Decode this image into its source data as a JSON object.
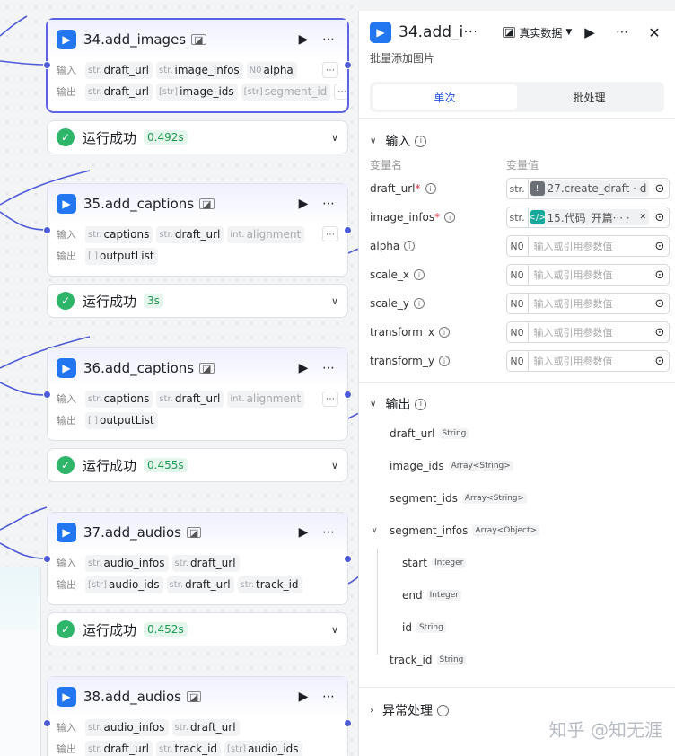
{
  "nodes": [
    {
      "title": "34.add_images",
      "input_label": "输入",
      "output_label": "输出",
      "inputs": [
        {
          "type": "str.",
          "name": "draft_url"
        },
        {
          "type": "str.",
          "name": "image_infos"
        },
        {
          "type": "N0",
          "name": "alpha"
        }
      ],
      "outputs": [
        {
          "type": "str.",
          "name": "draft_url"
        },
        {
          "type": "[str]",
          "name": "image_ids"
        },
        {
          "type": "[str]",
          "name": "segment_id"
        }
      ],
      "status": "运行成功",
      "time": "0.492s"
    },
    {
      "title": "35.add_captions",
      "input_label": "输入",
      "output_label": "输出",
      "inputs": [
        {
          "type": "str.",
          "name": "captions"
        },
        {
          "type": "str.",
          "name": "draft_url"
        },
        {
          "type": "int.",
          "name": "alignment"
        }
      ],
      "outputs": [
        {
          "type": "[ ]",
          "name": "outputList"
        }
      ],
      "status": "运行成功",
      "time": "3s"
    },
    {
      "title": "36.add_captions",
      "input_label": "输入",
      "output_label": "输出",
      "inputs": [
        {
          "type": "str.",
          "name": "captions"
        },
        {
          "type": "str.",
          "name": "draft_url"
        },
        {
          "type": "int.",
          "name": "alignment"
        }
      ],
      "outputs": [
        {
          "type": "[ ]",
          "name": "outputList"
        }
      ],
      "status": "运行成功",
      "time": "0.455s"
    },
    {
      "title": "37.add_audios",
      "input_label": "输入",
      "output_label": "输出",
      "inputs": [
        {
          "type": "str.",
          "name": "audio_infos"
        },
        {
          "type": "str.",
          "name": "draft_url"
        }
      ],
      "outputs": [
        {
          "type": "[str]",
          "name": "audio_ids"
        },
        {
          "type": "str.",
          "name": "draft_url"
        },
        {
          "type": "str.",
          "name": "track_id"
        }
      ],
      "status": "运行成功",
      "time": "0.452s"
    },
    {
      "title": "38.add_audios",
      "input_label": "输入",
      "output_label": "输出",
      "inputs": [
        {
          "type": "str.",
          "name": "audio_infos"
        },
        {
          "type": "str.",
          "name": "draft_url"
        }
      ],
      "outputs": [
        {
          "type": "str.",
          "name": "draft_url"
        },
        {
          "type": "str.",
          "name": "track_id"
        },
        {
          "type": "[str]",
          "name": "audio_ids"
        }
      ]
    }
  ],
  "panel": {
    "title": "34.add_i···",
    "mode": "真实数据",
    "description": "批量添加图片",
    "tabs": [
      "单次",
      "批处理"
    ],
    "input_section": "输入",
    "col_name": "变量名",
    "col_value": "变量值",
    "params": [
      {
        "name": "draft_url",
        "required": true,
        "type": "str.",
        "ref_icon": "!",
        "ref_text": "27.create_draft · d",
        "ref_color": "#6b6f76"
      },
      {
        "name": "image_infos",
        "required": true,
        "type": "str.",
        "ref_icon": "</>",
        "ref_text": "15.代码_开篇··· ·",
        "ref_color": "#16a89a"
      },
      {
        "name": "alpha",
        "type": "N0",
        "placeholder": "输入或引用参数值"
      },
      {
        "name": "scale_x",
        "type": "N0",
        "placeholder": "输入或引用参数值"
      },
      {
        "name": "scale_y",
        "type": "N0",
        "placeholder": "输入或引用参数值"
      },
      {
        "name": "transform_x",
        "type": "N0",
        "placeholder": "输入或引用参数值"
      },
      {
        "name": "transform_y",
        "type": "N0",
        "placeholder": "输入或引用参数值"
      }
    ],
    "output_section": "输出",
    "outputs": [
      {
        "name": "draft_url",
        "type": "String",
        "level": 0
      },
      {
        "name": "image_ids",
        "type": "Array<String>",
        "level": 0
      },
      {
        "name": "segment_ids",
        "type": "Array<String>",
        "level": 0
      },
      {
        "name": "segment_infos",
        "type": "Array<Object>",
        "level": 0,
        "expandable": true
      },
      {
        "name": "start",
        "type": "Integer",
        "level": 1
      },
      {
        "name": "end",
        "type": "Integer",
        "level": 1
      },
      {
        "name": "id",
        "type": "String",
        "level": 1
      },
      {
        "name": "track_id",
        "type": "String",
        "level": 0
      }
    ],
    "error_section": "异常处理"
  },
  "watermark": "知乎 @知无涯",
  "colors": {
    "accent": "#1f4ee0",
    "selected_border": "#5d63e6",
    "success": "#2fb56a",
    "edge": "#4e5bd8"
  }
}
